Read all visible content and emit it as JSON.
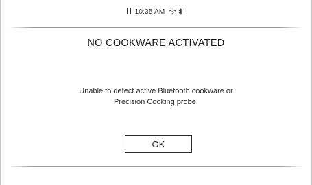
{
  "status_bar": {
    "time": "10:35 AM",
    "icons": [
      "phone-icon",
      "wifi-icon",
      "bluetooth-icon"
    ]
  },
  "dialog": {
    "title": "NO COOKWARE ACTIVATED",
    "message_line1": "Unable to detect active Bluetooth cookware or",
    "message_line2": "Precision Cooking probe.",
    "ok_label": "OK"
  }
}
